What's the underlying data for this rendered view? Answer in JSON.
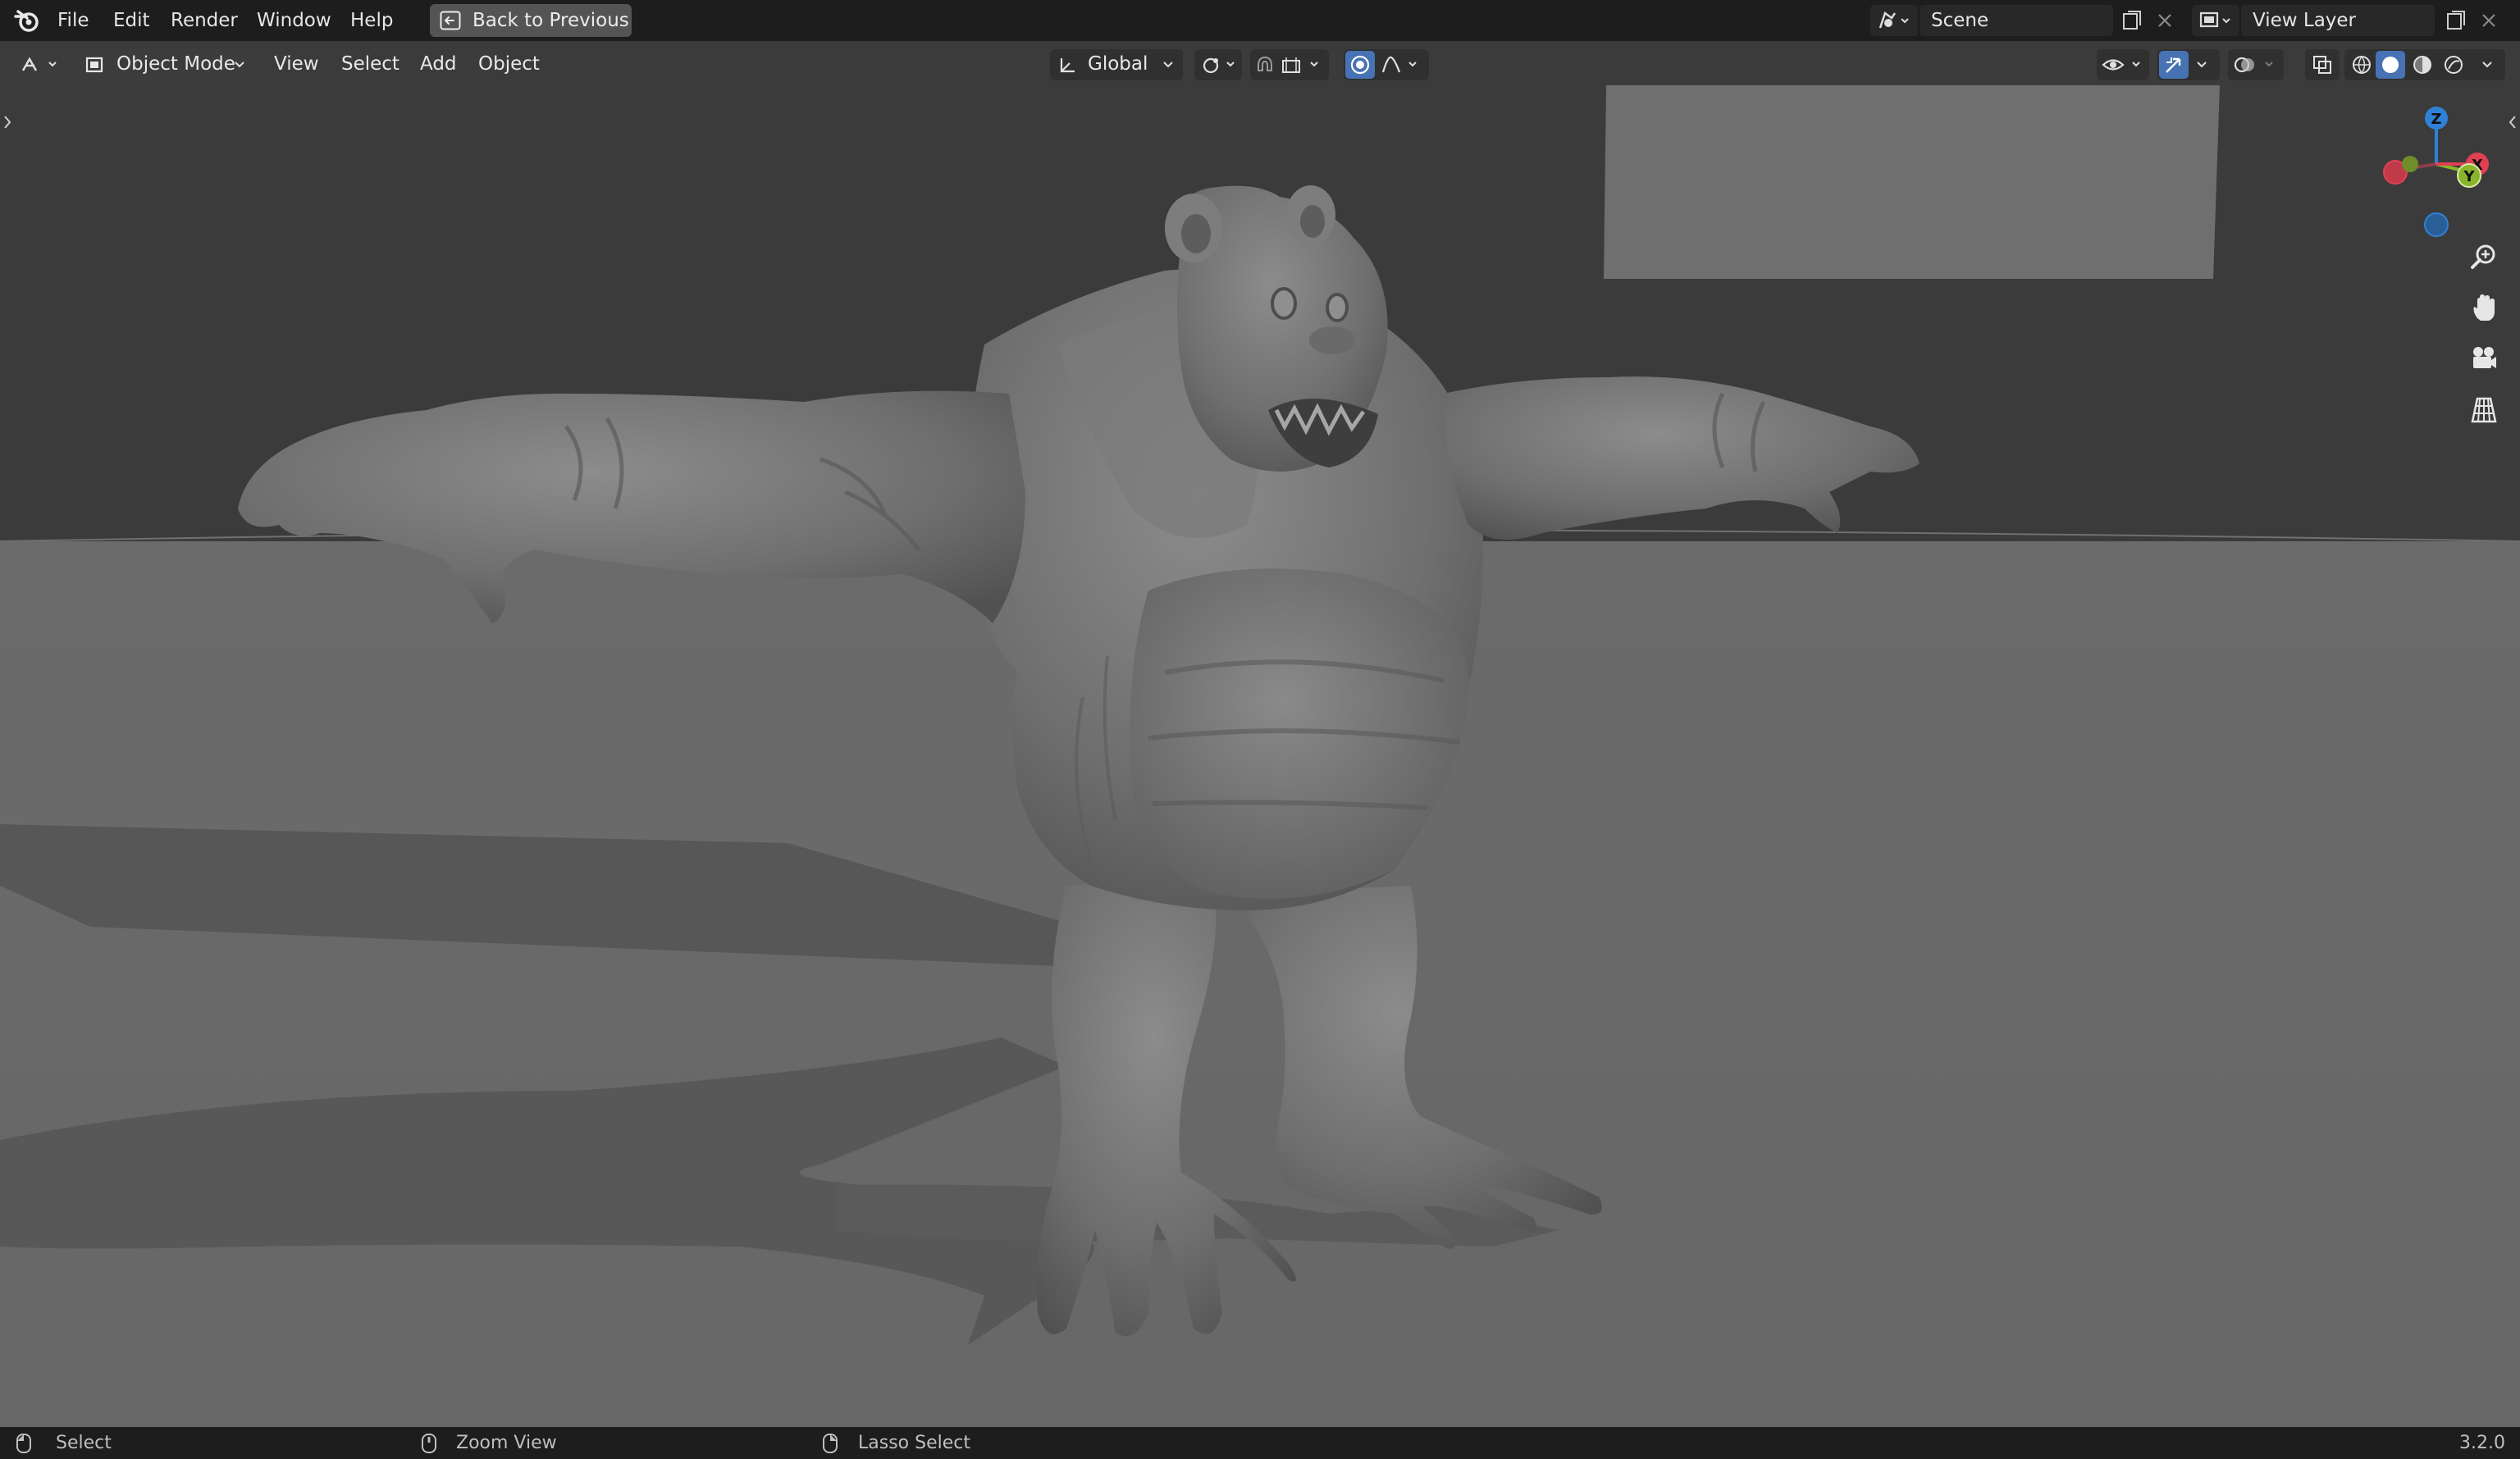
{
  "menubar": {
    "logo_icon": "blender-logo-icon",
    "items": [
      "File",
      "Edit",
      "Render",
      "Window",
      "Help"
    ],
    "back_button": "Back to Previous"
  },
  "scene": {
    "icon": "scene-icon",
    "name": "Scene"
  },
  "view_layer": {
    "icon": "view-layer-icon",
    "name": "View Layer"
  },
  "viewport_header": {
    "editor_type_icon": "3d-viewport-icon",
    "mode": "Object Mode",
    "menus": [
      "View",
      "Select",
      "Add",
      "Object"
    ],
    "transform_orientation": "Global",
    "pivot_icon": "pivot-point-icon",
    "snap_icon": "snap-magnet-icon",
    "snap_target_icon": "snap-increment-icon",
    "proportional_icon": "proportional-editing-icon",
    "falloff_icon": "falloff-curve-icon",
    "visibility_icon": "eye-visibility-icon",
    "gizmo_icon": "gizmo-toggle-icon",
    "overlay_icon": "overlays-icon",
    "xray_icon": "xray-toggle-icon",
    "shading_modes": [
      "wireframe",
      "solid",
      "material-preview",
      "rendered"
    ],
    "active_shading": "solid",
    "accent_color": "#4772b3"
  },
  "navigation": {
    "axes": {
      "z": "Z",
      "y": "Y",
      "x": "X"
    },
    "axis_colors": {
      "x": "#e14054",
      "y": "#89b52d",
      "z": "#2f81d8"
    },
    "tools": [
      "zoom-icon",
      "pan-hand-icon",
      "camera-view-icon",
      "perspective-grid-icon"
    ]
  },
  "statusbar": {
    "items": [
      {
        "icon": "mouse-left-icon",
        "label": "Select"
      },
      {
        "icon": "mouse-middle-icon",
        "label": "Zoom View"
      },
      {
        "icon": "mouse-right-icon",
        "label": "Lasso Select"
      }
    ],
    "version": "3.2.0"
  }
}
